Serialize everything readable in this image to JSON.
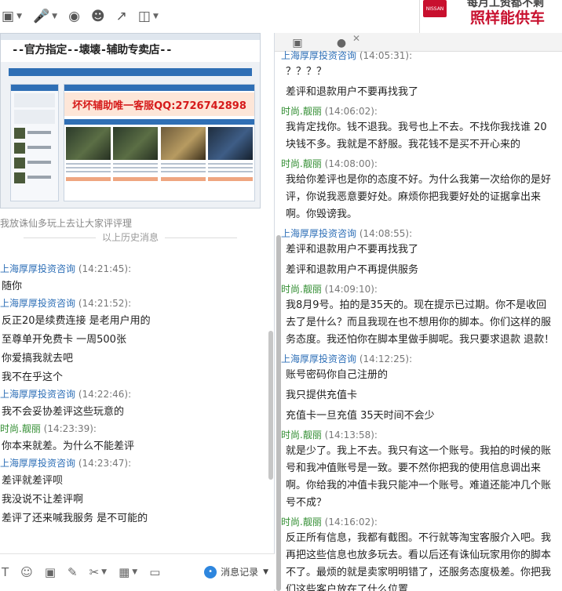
{
  "toolbar": {
    "icons": [
      "file-transfer-icon",
      "microphone-icon",
      "camera-icon",
      "contacts-icon",
      "share-screen-icon",
      "remote-assist-icon"
    ]
  },
  "ad": {
    "logo": "NISSAN",
    "line1": "每月工资都不剩",
    "line2": "照样能供车"
  },
  "shared_screenshot": {
    "banner": "--官方指定--壊壊-辅助专卖店--",
    "qq_ad": "坏坏辅助唯一客服QQ:2726742898"
  },
  "left": {
    "history_note": "我放诛仙多玩上去让大家评评理",
    "history_sep": "以上历史消息",
    "messages": [
      {
        "sender": "上海厚厚投资咨询",
        "time": "(14:21:45):",
        "lines": [
          "随你"
        ],
        "color": "blue"
      },
      {
        "sender": "上海厚厚投资咨询",
        "time": "(14:21:52):",
        "lines": [
          "反正20是续费连接 是老用户用的",
          "至尊单开免费卡 一周500张",
          "你爱搞我就去吧",
          "我不在乎这个"
        ],
        "color": "blue"
      },
      {
        "sender": "上海厚厚投资咨询",
        "time": "(14:22:46):",
        "lines": [
          "我不会妥协差评这些玩意的"
        ],
        "color": "blue"
      },
      {
        "sender": "时尚.靓丽",
        "time": "(14:23:39):",
        "lines": [
          "你本来就差。为什么不能差评"
        ],
        "color": "green"
      },
      {
        "sender": "上海厚厚投资咨询",
        "time": "(14:23:47):",
        "lines": [
          "差评就差评呗",
          "我没说不让差评啊",
          "差评了还来喊我服务 是不可能的"
        ],
        "color": "blue"
      }
    ],
    "toolbar": {
      "record_label": "消息记录"
    }
  },
  "right": {
    "messages": [
      {
        "sender": "上海厚厚投资咨询",
        "time": "(14:05:31):",
        "lines": [
          "？？？？",
          "差评和退款用户不要再找我了"
        ],
        "color": "blue"
      },
      {
        "sender": "时尚.靓丽",
        "time": "(14:06:02):",
        "lines": [
          "我肯定找你。钱不退我。我号也上不去。不找你我找谁 20块钱不多。我就是不舒服。我花钱不是买不开心来的"
        ],
        "color": "green"
      },
      {
        "sender": "时尚.靓丽",
        "time": "(14:08:00):",
        "lines": [
          "我给你差评也是你的态度不好。为什么我第一次给你的是好评，你说我恶意要好处。麻烦你把我要好处的证据拿出来啊。你毁谤我。"
        ],
        "color": "green"
      },
      {
        "sender": "上海厚厚投资咨询",
        "time": "(14:08:55):",
        "lines": [
          "差评和退款用户不要再找我了",
          "差评和退款用户不再提供服务"
        ],
        "color": "blue"
      },
      {
        "sender": "时尚.靓丽",
        "time": "(14:09:10):",
        "lines": [
          "我8月9号。拍的是35天的。现在提示已过期。你不是收回去了是什么？而且我现在也不想用你的脚本。你们这样的服务态度。我还怕你在脚本里做手脚呢。我只要求退款 退款！"
        ],
        "color": "green"
      },
      {
        "sender": "上海厚厚投资咨询",
        "time": "(14:12:25):",
        "lines": [
          "账号密码你自己注册的",
          "我只提供充值卡",
          "充值卡一旦充值  35天时间不会少"
        ],
        "color": "blue"
      },
      {
        "sender": "时尚.靓丽",
        "time": "(14:13:58):",
        "lines": [
          "就是少了。我上不去。我只有这一个账号。我拍的时候的账号和我冲值账号是一致。要不然你把我的使用信息调出来啊。你给我的冲值卡我只能冲一个账号。难道还能冲几个账号不成？"
        ],
        "color": "green"
      },
      {
        "sender": "时尚.靓丽",
        "time": "(14:16:02):",
        "lines": [
          "反正所有信息，我都有截图。不行就等淘宝客服介入吧。我再把这些信息也放多玩去。看以后还有诛仙玩家用你的脚本不了。最烦的就是卖家明明错了，还服务态度极差。你把我们这些客户放在了什么位置"
        ],
        "color": "green"
      }
    ]
  }
}
